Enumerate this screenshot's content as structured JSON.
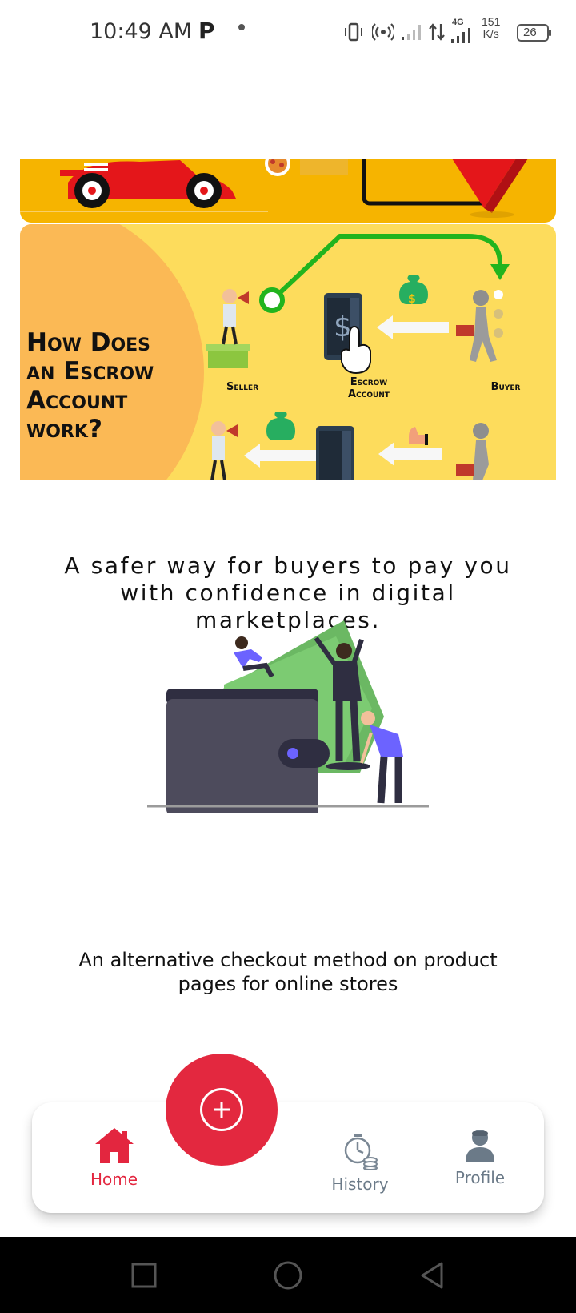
{
  "status_bar": {
    "time": "10:49 AM",
    "app_letter": "P",
    "network": "4G",
    "speed_value": "151",
    "speed_unit": "K/s",
    "battery": "26"
  },
  "banner": {
    "heading": "How Does an Escrow Account work?",
    "labels": {
      "seller": "Seller",
      "escrow": "Escrow Account",
      "buyer": "Buyer"
    },
    "colors": {
      "top_bg": "#f6b400",
      "main_bg": "#fddc5c",
      "circle": "#fbb955",
      "arrow": "#22b41e"
    }
  },
  "main": {
    "tagline": "A safer way for buyers to pay you with confidence in digital marketplaces.",
    "subtext": "An alternative checkout method on product pages for online stores"
  },
  "bottom_nav": {
    "items": [
      {
        "label": "Home",
        "icon": "home-icon",
        "active": true
      },
      {
        "label": "History",
        "icon": "history-icon",
        "active": false
      },
      {
        "label": "Profile",
        "icon": "profile-icon",
        "active": false
      }
    ],
    "fab_icon": "plus-circle-icon",
    "accent": "#e3283f",
    "inactive_color": "#6b7a88"
  },
  "system_nav": {
    "buttons": [
      "recents-icon",
      "home-circle-icon",
      "back-icon"
    ]
  }
}
